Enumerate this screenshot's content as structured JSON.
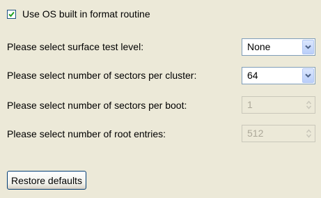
{
  "use_os_format": {
    "label": "Use OS built in format routine",
    "checked": true
  },
  "surface_test": {
    "label": "Please select surface test level:",
    "value": "None"
  },
  "sectors_per_cluster": {
    "label": "Please select number of sectors per cluster:",
    "value": "64"
  },
  "sectors_per_boot": {
    "label": "Please select number of sectors per boot:",
    "value": "1",
    "disabled": true
  },
  "root_entries": {
    "label": "Please select number of root entries:",
    "value": "512",
    "disabled": true
  },
  "restore_button": {
    "label": "Restore defaults"
  },
  "icons": {
    "checkbox": "checkmark-icon",
    "dropdown": "chevron-down-icon",
    "spin": "spin-arrows-icon"
  },
  "colors": {
    "background": "#ECE9D8",
    "accent": "#1C5180",
    "disabled_text": "#ACA899"
  }
}
